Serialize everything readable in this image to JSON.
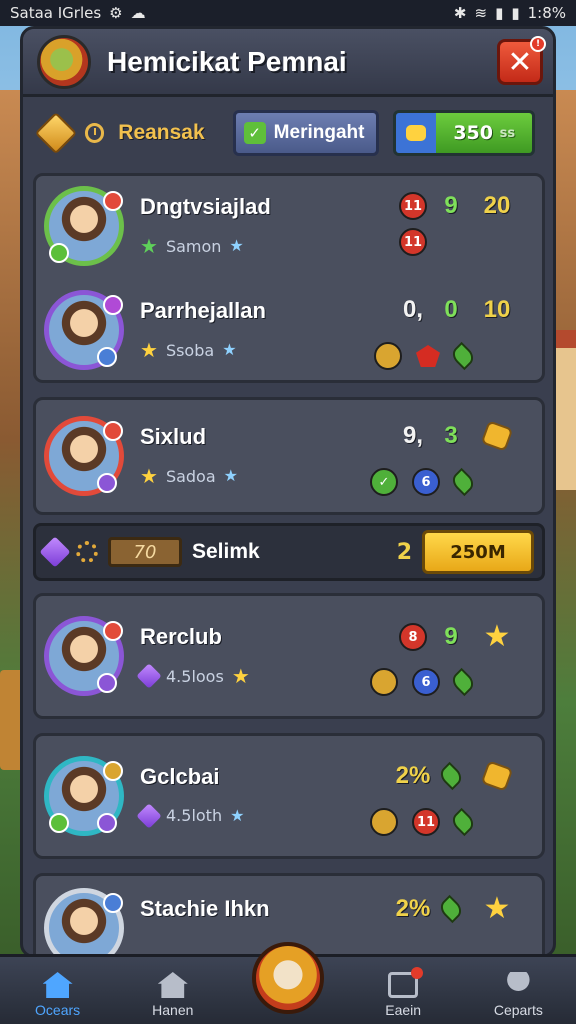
{
  "statusbar": {
    "left_text": "Sataa IGrles",
    "time": "1:8%"
  },
  "header": {
    "title": "Hemicikat Pemnai"
  },
  "toolbar": {
    "tab1_label": "Reansak",
    "tab2_label": "Meringaht",
    "currency_value": "350",
    "currency_suffix": "ss"
  },
  "players": [
    {
      "name": "Dngtvsiajlad",
      "sub": "Samon",
      "n1": "9",
      "n2": "20"
    },
    {
      "name": "Parrhejallan",
      "sub": "Ssoba",
      "n0": "0,",
      "n1": "0",
      "n2": "10"
    },
    {
      "name": "Sixlud",
      "sub": "Sadoa",
      "n0": "9,",
      "n1": "3"
    },
    {
      "name": "Rerclub",
      "sub": "4.5loos",
      "n1": "9"
    },
    {
      "name": "Gclcbai",
      "sub": "4.5loth",
      "n0": "2%"
    },
    {
      "name": "Stachie Ihkn",
      "n0": "2%"
    }
  ],
  "badges": {
    "b1": "11",
    "b2": "11",
    "b3": "6",
    "b4": "8",
    "b5": "6",
    "b6": "11"
  },
  "reward": {
    "progress": "70",
    "label": "Selimk",
    "count": "2",
    "button": "250M"
  },
  "nav": [
    "Ocears",
    "Hanen",
    "Eaein",
    "Ceparts"
  ],
  "colors": {
    "panel": "#3a3f4f",
    "accent": "#f0d24a",
    "nav_active": "#4fa6ff"
  }
}
